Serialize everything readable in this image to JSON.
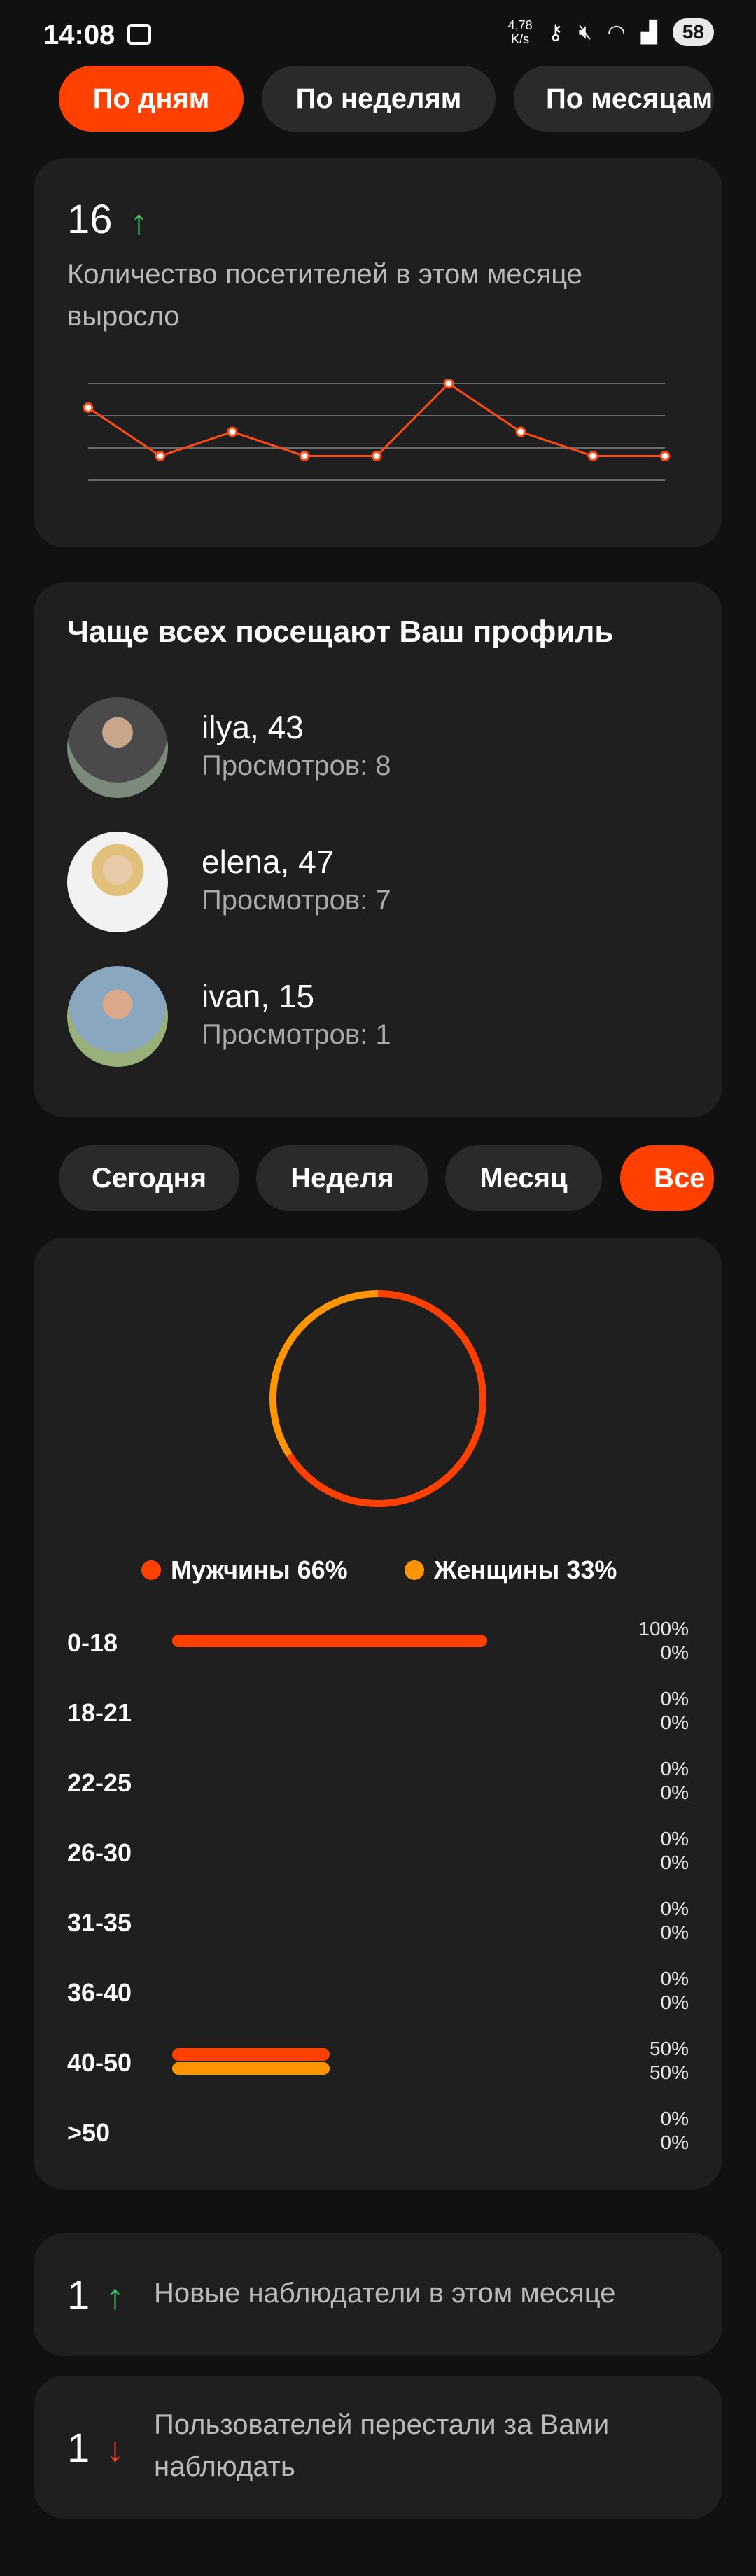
{
  "status": {
    "time": "14:08",
    "speed_value": "4,78",
    "speed_unit": "K/s",
    "battery": "58"
  },
  "period_tabs": [
    "По дням",
    "По неделям",
    "По месяцам"
  ],
  "visitors": {
    "count": "16",
    "trend_icon": "arrow-up-green",
    "description": "Количество посетителей в этом месяце выросло",
    "chart_data": {
      "type": "line",
      "values": [
        3,
        1,
        2,
        1,
        1,
        4,
        2,
        1,
        1
      ],
      "ylim": [
        0,
        4
      ],
      "grid": true,
      "line_color": "#ff4a14"
    }
  },
  "frequent_visitors": {
    "title": "Чаще всех посещают Ваш профиль",
    "items": [
      {
        "name": "ilya, 43",
        "views": "Просмотров: 8"
      },
      {
        "name": "elena, 47",
        "views": "Просмотров: 7"
      },
      {
        "name": "ivan, 15",
        "views": "Просмотров: 1"
      }
    ]
  },
  "range_tabs": [
    "Сегодня",
    "Неделя",
    "Месяц",
    "Все"
  ],
  "gender": {
    "legend": [
      "Мужчины 66%",
      "Женщины 33%"
    ],
    "colors": {
      "male": "#ff4000",
      "female": "#ff9500"
    },
    "male_share": 0.66,
    "female_share": 0.33
  },
  "ages": [
    {
      "label": "0-18",
      "male": "100%",
      "female": "0%",
      "male_v": 1.0,
      "female_v": 0
    },
    {
      "label": "18-21",
      "male": "0%",
      "female": "0%",
      "male_v": 0,
      "female_v": 0
    },
    {
      "label": "22-25",
      "male": "0%",
      "female": "0%",
      "male_v": 0,
      "female_v": 0
    },
    {
      "label": "26-30",
      "male": "0%",
      "female": "0%",
      "male_v": 0,
      "female_v": 0
    },
    {
      "label": "31-35",
      "male": "0%",
      "female": "0%",
      "male_v": 0,
      "female_v": 0
    },
    {
      "label": "36-40",
      "male": "0%",
      "female": "0%",
      "male_v": 0,
      "female_v": 0
    },
    {
      "label": "40-50",
      "male": "50%",
      "female": "50%",
      "male_v": 0.5,
      "female_v": 0.5
    },
    {
      "label": ">50",
      "male": "0%",
      "female": "0%",
      "male_v": 0,
      "female_v": 0
    }
  ],
  "new_followers": {
    "count": "1",
    "text": "Новые наблюдатели в этом месяце"
  },
  "lost_followers": {
    "count": "1",
    "text": "Пользователей перестали за Вами наблюдать"
  }
}
